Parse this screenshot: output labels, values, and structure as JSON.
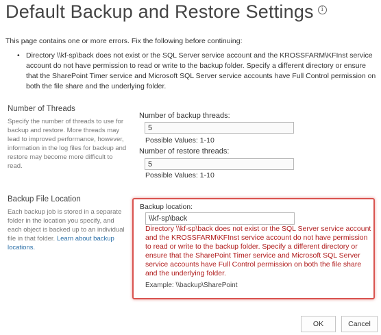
{
  "page": {
    "title": "Default Backup and Restore Settings",
    "info_icon": "info-icon"
  },
  "errors": {
    "intro": "This page contains one or more errors. Fix the following before continuing:",
    "items": [
      "Directory \\\\kf-sp\\back does not exist or the SQL Server service account and the KROSSFARM\\KFInst service account do not have permission to read or write to the backup folder. Specify a different directory or ensure that the SharePoint Timer service and Microsoft SQL Server service accounts have Full Control permission on both the file share and the underlying folder."
    ]
  },
  "threads": {
    "section_title": "Number of Threads",
    "description": "Specify the number of threads to use for backup and restore. More threads may lead to improved performance, however, information in the log files for backup and restore may become more difficult to read.",
    "backup_label": "Number of backup threads:",
    "backup_value": "5",
    "backup_hint": "Possible Values: 1-10",
    "restore_label": "Number of restore threads:",
    "restore_value": "5",
    "restore_hint": "Possible Values: 1-10"
  },
  "location": {
    "section_title": "Backup File Location",
    "description": "Each backup job is stored in a separate folder in the location you specify, and each object is backed up to an individual file in that folder.",
    "learn_more": "Learn about backup locations.",
    "label": "Backup location:",
    "value": "\\\\kf-sp\\back",
    "error": "Directory \\\\kf-sp\\back does not exist or the SQL Server service account and the KROSSFARM\\KFInst service account do not have permission to read or write to the backup folder. Specify a different directory or ensure that the SharePoint Timer service and Microsoft SQL Server service accounts have Full Control permission on both the file share and the underlying folder.",
    "example": "Example: \\\\backup\\SharePoint"
  },
  "buttons": {
    "ok": "OK",
    "cancel": "Cancel"
  },
  "colors": {
    "error_text": "#b01c1c",
    "error_border": "#d9534f",
    "link": "#2a6fa8"
  }
}
